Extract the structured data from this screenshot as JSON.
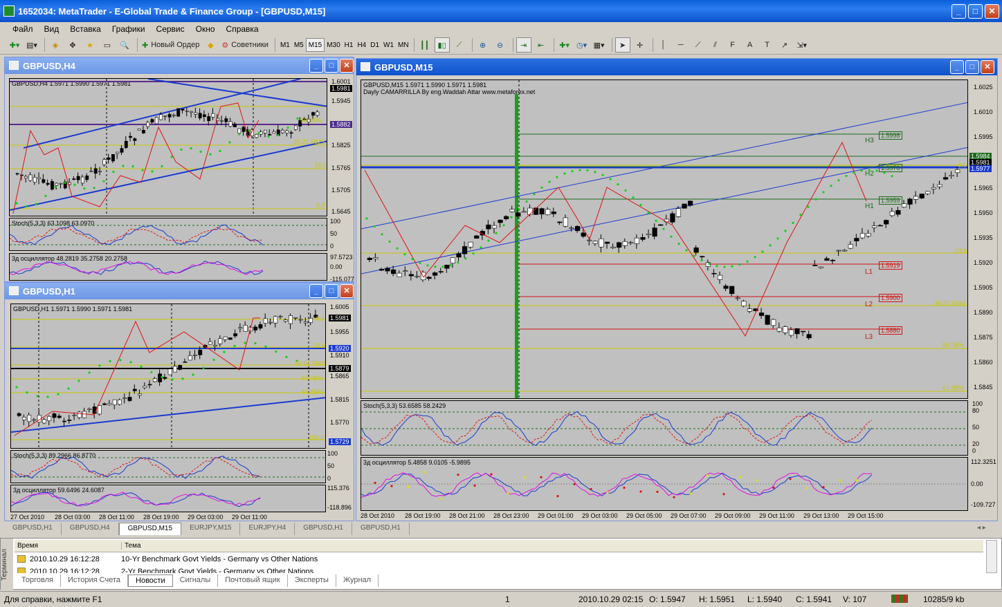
{
  "app": {
    "title": "1652034: MetaTrader - E-Global Trade & Finance Group - [GBPUSD,M15]"
  },
  "menu": [
    "Файл",
    "Вид",
    "Вставка",
    "Графики",
    "Сервис",
    "Окно",
    "Справка"
  ],
  "toolbar": {
    "new_order": "Новый Ордер",
    "experts": "Советники",
    "timeframes": [
      "M1",
      "M5",
      "M15",
      "M30",
      "H1",
      "H4",
      "D1",
      "W1",
      "MN"
    ],
    "selected_tf": "M15"
  },
  "win_h4": {
    "title": "GBPUSD,H4",
    "info": "GBPUSD,H4  1.5971 1.5990 1.5971 1.5981",
    "stoch": "Stoch(5,3,3) 63.1098 63.0970",
    "osc": "3д осциллятор 48.2819 35.2758 20.2758",
    "prices": [
      "1.6001",
      "1.5981",
      "1.5945",
      "1.5882",
      "1.5825",
      "1.5765",
      "1.5705",
      "1.5645"
    ],
    "price_tags": [
      "1.6001",
      "1.5981",
      "1.5882"
    ],
    "fib": [
      "50.0$%",
      "38.21.5825",
      "23.6",
      "0.0"
    ],
    "stoch_axis": [
      "100",
      "50",
      "0"
    ],
    "osc_axis": [
      "97.5723",
      "0.00",
      "-115.077"
    ]
  },
  "win_h1": {
    "title": "GBPUSD,H1",
    "info": "GBPUSD,H1  1.5971 1.5990 1.5971 1.5981",
    "stoch": "Stoch(5,3,3) 89.2966 86.8770",
    "osc": "3д осциллятор 59.6496 24.6087",
    "prices": [
      "1.6005",
      "1.5955",
      "1.5910",
      "1.5865",
      "1.5815",
      "1.5770",
      "1.5725"
    ],
    "price_tags": [
      "1.5981",
      "1.5920",
      "1.5879",
      "1.5729"
    ],
    "fib": [
      "0.0",
      "23.6",
      "38.21.5883",
      "50.0$%",
      "61.8$%",
      "100.0"
    ],
    "stoch_axis": [
      "100",
      "50",
      "0"
    ],
    "osc_axis": [
      "115.376",
      "-118.896"
    ],
    "xaxis": [
      "27 Oct 2010",
      "28 Oct 03:00",
      "28 Oct 11:00",
      "28 Oct 19:00",
      "29 Oct 03:00",
      "29 Oct 11:00"
    ]
  },
  "win_m15": {
    "title": "GBPUSD,M15",
    "info": "GBPUSD,M15  1.5971 1.5990 1.5971 1.5981",
    "indicator": "Dayly CAMARRILLA By eng.Waddah Attar www.metaforex.net",
    "stoch": "Stoch(5,3,3) 53.6585 58.2429",
    "osc": "3д осциллятор 5.4858 9.0105 -5.9895",
    "prices": [
      "1.6025",
      "1.6010",
      "1.5995",
      "1.5965",
      "1.5950",
      "1.5935",
      "1.5920",
      "1.5905",
      "1.5890",
      "1.5875",
      "1.5860",
      "1.5845"
    ],
    "price_tags": [
      "1.5984",
      "1.5981",
      "1.5977"
    ],
    "levels": [
      {
        "name": "H3",
        "val": "1.5998"
      },
      {
        "name": "H2",
        "val": "1.5978"
      },
      {
        "name": "H1",
        "val": "1.5959"
      },
      {
        "name": "L1",
        "val": "1.5919"
      },
      {
        "name": "L2",
        "val": "1.5900"
      },
      {
        "name": "L3",
        "val": "1.5880"
      }
    ],
    "fib": [
      "0.0",
      "23.6",
      "38.21.5894",
      "50.0$%",
      "61.8$%"
    ],
    "stoch_axis": [
      "100",
      "80",
      "50",
      "20",
      "0"
    ],
    "osc_axis": [
      "112.3251",
      "0.00",
      "-109.727"
    ],
    "xaxis": [
      "28 Oct 2010",
      "28 Oct 19:00",
      "28 Oct 21:00",
      "28 Oct 23:00",
      "29 Oct 01:00",
      "29 Oct 03:00",
      "29 Oct 05:00",
      "29 Oct 07:00",
      "29 Oct 09:00",
      "29 Oct 11:00",
      "29 Oct 13:00",
      "29 Oct 15:00"
    ]
  },
  "chart_tabs": [
    "GBPUSD,H1",
    "GBPUSD,H4",
    "GBPUSD,M15",
    "EURJPY,M15",
    "EURJPY,H4",
    "GBPUSD,H1",
    "GBPUSD,H1"
  ],
  "active_chart_tab": "GBPUSD,M15",
  "terminal": {
    "side": "Терминал",
    "col_time": "Время",
    "col_subject": "Тема",
    "rows": [
      {
        "time": "2010.10.29 16:12:28",
        "subject": "10-Yr Benchmark Govt Yields - Germany vs Other Nations"
      },
      {
        "time": "2010.10.29 16:12:28",
        "subject": "2-Yr Benchmark Govt Yields - Germany vs Other Nations"
      }
    ],
    "tabs": [
      "Торговля",
      "История Счета",
      "Новости",
      "Сигналы",
      "Почтовый ящик",
      "Эксперты",
      "Журнал"
    ],
    "active_tab": "Новости"
  },
  "status": {
    "help": "Для справки, нажмите F1",
    "profile": "1",
    "datetime": "2010.10.29 02:15",
    "open": "O: 1.5947",
    "high": "H: 1.5951",
    "low": "L: 1.5940",
    "close": "C: 1.5941",
    "volume": "V: 107",
    "traffic": "10285/9 kb"
  }
}
